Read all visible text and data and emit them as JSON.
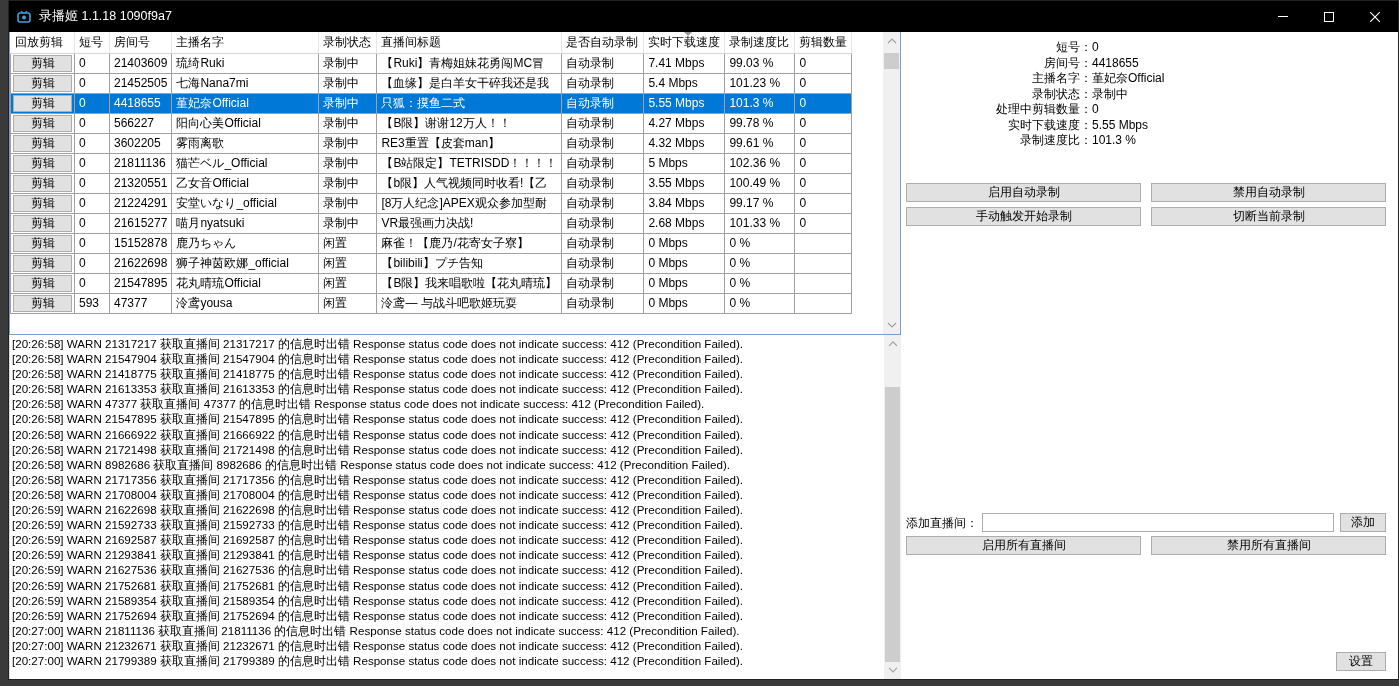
{
  "window": {
    "title": "录播姬 1.1.18 1090f9a7"
  },
  "table": {
    "columns": [
      {
        "label": "回放剪辑",
        "kind": "button",
        "sorted": false
      },
      {
        "label": "短号",
        "kind": "text",
        "sorted": false
      },
      {
        "label": "房间号",
        "kind": "text",
        "sorted": false
      },
      {
        "label": "主播名字",
        "kind": "text",
        "sorted": false
      },
      {
        "label": "录制状态",
        "kind": "text",
        "sorted": false
      },
      {
        "label": "直播间标题",
        "kind": "text",
        "sorted": false
      },
      {
        "label": "是否自动录制",
        "kind": "text",
        "sorted": false
      },
      {
        "label": "实时下载速度",
        "kind": "text",
        "sorted": true
      },
      {
        "label": "录制速度比",
        "kind": "text",
        "sorted": false
      },
      {
        "label": "剪辑数量",
        "kind": "text",
        "sorted": false
      }
    ],
    "rows": [
      {
        "selected": false,
        "cells": [
          "剪辑",
          "0",
          "21403609",
          "琉绮Ruki",
          "录制中",
          "【Ruki】青梅姐妹花勇闯MC冒",
          "自动录制",
          "7.41 Mbps",
          "99.03 %",
          "0"
        ]
      },
      {
        "selected": false,
        "cells": [
          "剪辑",
          "0",
          "21452505",
          "七海Nana7mi",
          "录制中",
          "【血缘】是白羊女干碎我还是我",
          "自动录制",
          "5.4 Mbps",
          "101.23 %",
          "0"
        ]
      },
      {
        "selected": true,
        "cells": [
          "剪辑",
          "0",
          "4418655",
          "堇妃奈Official",
          "录制中",
          "只狐：摸鱼二式",
          "自动录制",
          "5.55 Mbps",
          "101.3 %",
          "0"
        ]
      },
      {
        "selected": false,
        "cells": [
          "剪辑",
          "0",
          "566227",
          "阳向心美Official",
          "录制中",
          "【B限】谢谢12万人！！",
          "自动录制",
          "4.27 Mbps",
          "99.78 %",
          "0"
        ]
      },
      {
        "selected": false,
        "cells": [
          "剪辑",
          "0",
          "3602205",
          "雾雨离歌",
          "录制中",
          "RE3重置【皮套man】",
          "自动录制",
          "4.32 Mbps",
          "99.61 %",
          "0"
        ]
      },
      {
        "selected": false,
        "cells": [
          "剪辑",
          "0",
          "21811136",
          "猫芒ベル_Official",
          "录制中",
          "【B站限定】TETRISDD！！！！",
          "自动录制",
          "5 Mbps",
          "102.36 %",
          "0"
        ]
      },
      {
        "selected": false,
        "cells": [
          "剪辑",
          "0",
          "21320551",
          "乙女音Official",
          "录制中",
          "【b限】人气视频同时收看!【乙",
          "自动录制",
          "3.55 Mbps",
          "100.49 %",
          "0"
        ]
      },
      {
        "selected": false,
        "cells": [
          "剪辑",
          "0",
          "21224291",
          "安堂いなり_official",
          "录制中",
          "[8万人纪念]APEX观众参加型耐",
          "自动录制",
          "3.84 Mbps",
          "99.17 %",
          "0"
        ]
      },
      {
        "selected": false,
        "cells": [
          "剪辑",
          "0",
          "21615277",
          "喵月nyatsuki",
          "录制中",
          "VR最强画力决战!",
          "自动录制",
          "2.68 Mbps",
          "101.33 %",
          "0"
        ]
      },
      {
        "selected": false,
        "cells": [
          "剪辑",
          "0",
          "15152878",
          "鹿乃ちゃん",
          "闲置",
          "麻雀！【鹿乃/花寄女子寮】",
          "自动录制",
          "0 Mbps",
          "0 %",
          ""
        ]
      },
      {
        "selected": false,
        "cells": [
          "剪辑",
          "0",
          "21622698",
          "狮子神茵欧娜_official",
          "闲置",
          "【bilibili】プチ告知",
          "自动录制",
          "0 Mbps",
          "0 %",
          ""
        ]
      },
      {
        "selected": false,
        "cells": [
          "剪辑",
          "0",
          "21547895",
          "花丸晴琉Official",
          "闲置",
          "【B限】我来唱歌啦【花丸晴琉】",
          "自动录制",
          "0 Mbps",
          "0 %",
          ""
        ]
      },
      {
        "selected": false,
        "cells": [
          "剪辑",
          "593",
          "47377",
          "泠鸢yousa",
          "闲置",
          "泠鸢— 与战斗吧歌姬玩耍",
          "自动录制",
          "0 Mbps",
          "0 %",
          ""
        ]
      }
    ]
  },
  "log": [
    "[20:26:58] WARN 21317217 获取直播间 21317217 的信息时出错 Response status code does not indicate success: 412 (Precondition Failed).",
    "[20:26:58] WARN 21547904 获取直播间 21547904 的信息时出错 Response status code does not indicate success: 412 (Precondition Failed).",
    "[20:26:58] WARN 21418775 获取直播间 21418775 的信息时出错 Response status code does not indicate success: 412 (Precondition Failed).",
    "[20:26:58] WARN 21613353 获取直播间 21613353 的信息时出错 Response status code does not indicate success: 412 (Precondition Failed).",
    "[20:26:58] WARN 47377 获取直播间 47377 的信息时出错 Response status code does not indicate success: 412 (Precondition Failed).",
    "[20:26:58] WARN 21547895 获取直播间 21547895 的信息时出错 Response status code does not indicate success: 412 (Precondition Failed).",
    "[20:26:58] WARN 21666922 获取直播间 21666922 的信息时出错 Response status code does not indicate success: 412 (Precondition Failed).",
    "[20:26:58] WARN 21721498 获取直播间 21721498 的信息时出错 Response status code does not indicate success: 412 (Precondition Failed).",
    "[20:26:58] WARN 8982686 获取直播间 8982686 的信息时出错 Response status code does not indicate success: 412 (Precondition Failed).",
    "[20:26:58] WARN 21717356 获取直播间 21717356 的信息时出错 Response status code does not indicate success: 412 (Precondition Failed).",
    "[20:26:58] WARN 21708004 获取直播间 21708004 的信息时出错 Response status code does not indicate success: 412 (Precondition Failed).",
    "[20:26:59] WARN 21622698 获取直播间 21622698 的信息时出错 Response status code does not indicate success: 412 (Precondition Failed).",
    "[20:26:59] WARN 21592733 获取直播间 21592733 的信息时出错 Response status code does not indicate success: 412 (Precondition Failed).",
    "[20:26:59] WARN 21692587 获取直播间 21692587 的信息时出错 Response status code does not indicate success: 412 (Precondition Failed).",
    "[20:26:59] WARN 21293841 获取直播间 21293841 的信息时出错 Response status code does not indicate success: 412 (Precondition Failed).",
    "[20:26:59] WARN 21627536 获取直播间 21627536 的信息时出错 Response status code does not indicate success: 412 (Precondition Failed).",
    "[20:26:59] WARN 21752681 获取直播间 21752681 的信息时出错 Response status code does not indicate success: 412 (Precondition Failed).",
    "[20:26:59] WARN 21589354 获取直播间 21589354 的信息时出错 Response status code does not indicate success: 412 (Precondition Failed).",
    "[20:26:59] WARN 21752694 获取直播间 21752694 的信息时出错 Response status code does not indicate success: 412 (Precondition Failed).",
    "[20:27:00] WARN 21811136 获取直播间 21811136 的信息时出错 Response status code does not indicate success: 412 (Precondition Failed).",
    "[20:27:00] WARN 21232671 获取直播间 21232671 的信息时出错 Response status code does not indicate success: 412 (Precondition Failed).",
    "[20:27:00] WARN 21799389 获取直播间 21799389 的信息时出错 Response status code does not indicate success: 412 (Precondition Failed)."
  ],
  "details": [
    {
      "label": "短号：",
      "value": "0"
    },
    {
      "label": "房间号：",
      "value": "4418655"
    },
    {
      "label": "主播名字：",
      "value": "堇妃奈Official"
    },
    {
      "label": "录制状态：",
      "value": "录制中"
    },
    {
      "label": "处理中剪辑数量：",
      "value": "0"
    },
    {
      "label": "实时下载速度：",
      "value": "5.55 Mbps"
    },
    {
      "label": "录制速度比：",
      "value": "101.3 %"
    }
  ],
  "room_buttons": [
    "启用自动录制",
    "禁用自动录制",
    "手动触发开始录制",
    "切断当前录制"
  ],
  "add_room": {
    "label": "添加直播间：",
    "button": "添加"
  },
  "all_buttons": [
    "启用所有直播间",
    "禁用所有直播间"
  ],
  "settings_button": "设置"
}
